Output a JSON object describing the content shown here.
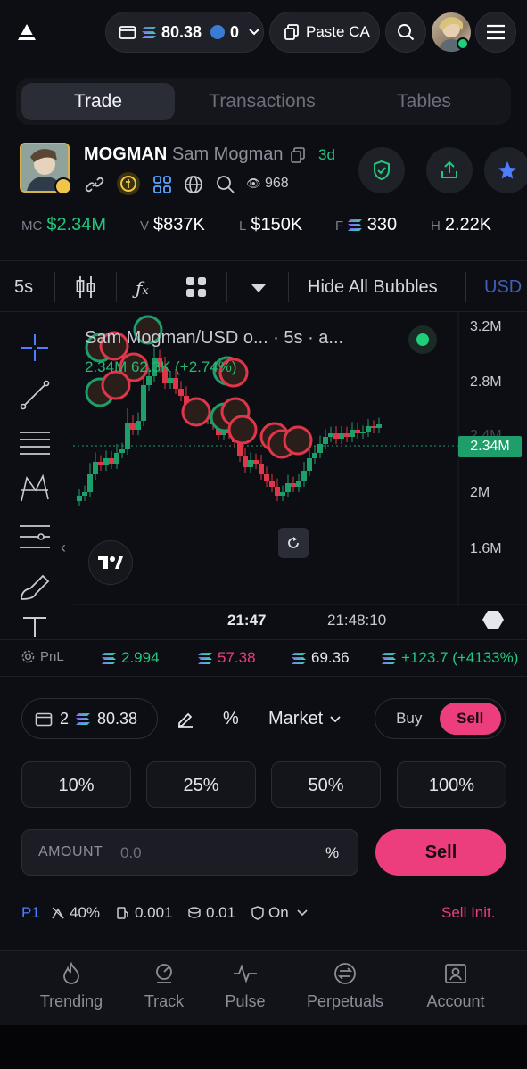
{
  "topbar": {
    "wallet_balance": "80.38",
    "wallet_count": "0",
    "paste_label": "Paste CA"
  },
  "tabs": [
    {
      "label": "Trade",
      "active": true
    },
    {
      "label": "Transactions",
      "active": false
    },
    {
      "label": "Tables",
      "active": false
    }
  ],
  "token": {
    "ticker": "MOGMAN",
    "name": "Sam Mogman",
    "age": "3d",
    "views": "968"
  },
  "stats": {
    "mc_label": "MC",
    "mc_value": "$2.34M",
    "v_label": "V",
    "v_value": "$837K",
    "l_label": "L",
    "l_value": "$150K",
    "f_label": "F",
    "f_value": "330",
    "h_label": "H",
    "h_value": "2.22K"
  },
  "chart_toolbar": {
    "interval": "5s",
    "hide_bubbles": "Hide All Bubbles",
    "currency": "USD"
  },
  "chart": {
    "legend_title": "Sam Mogman/USD o...",
    "legend_interval": "· 5s · a...",
    "legend_values": "2.34M  62.3K (+2.74%)",
    "y_ticks": [
      "3.2M",
      "2.8M",
      "2.4M",
      "2M",
      "1.6M"
    ],
    "current_price": "2.34M",
    "x_ticks": [
      "21:47",
      "21:48:10"
    ],
    "colors": {
      "up": "#1e9e6a",
      "down": "#e0364a"
    }
  },
  "pnl": {
    "label": "PnL",
    "bought": "2.994",
    "sold": "57.38",
    "holding": "69.36",
    "pnl": "+123.7 (+4133%)"
  },
  "form": {
    "wallets": "2",
    "balance": "80.38",
    "percent_symbol": "%",
    "order_type": "Market",
    "buy_label": "Buy",
    "sell_label": "Sell",
    "pct_buttons": [
      "10%",
      "25%",
      "50%",
      "100%"
    ],
    "amount_label": "AMOUNT",
    "amount_placeholder": "0.0",
    "amount_unit": "%",
    "sell_button": "Sell"
  },
  "settings": {
    "preset": "P1",
    "slippage": "40%",
    "priority": "0.001",
    "bribe": "0.01",
    "mev": "On",
    "sell_init": "Sell Init."
  },
  "bottom_nav": [
    {
      "label": "Trending"
    },
    {
      "label": "Track"
    },
    {
      "label": "Pulse"
    },
    {
      "label": "Perpetuals"
    },
    {
      "label": "Account"
    }
  ]
}
